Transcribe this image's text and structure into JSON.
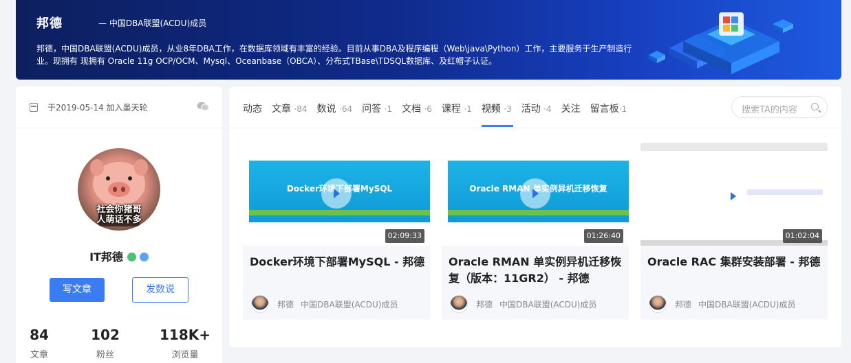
{
  "banner": {
    "name": "邦德",
    "org": "— 中国DBA联盟(ACDU)成员",
    "bio": "邦德，中国DBA联盟(ACDU)成员，从业8年DBA工作，在数据库领域有丰富的经验。目前从事DBA及程序编程（Web\\java\\Python）工作，主要服务于生产制造行业。现拥有 现拥有 Oracle 11g OCP/OCM、Mysql、Oceanbase（OBCA）、分布式TBase\\TDSQL数据库、及红帽子认证。"
  },
  "profile": {
    "joined": "于2019-05-14 加入墨天轮",
    "avatar_caption_1": "社会你猪哥",
    "avatar_caption_2": "人萌话不多",
    "username": "IT邦德",
    "write_button": "写文章",
    "post_button": "发数说",
    "stats": [
      {
        "num": "84",
        "label": "文章"
      },
      {
        "num": "102",
        "label": "粉丝"
      },
      {
        "num": "118K+",
        "label": "浏览量"
      }
    ]
  },
  "tabs": [
    {
      "label": "动态",
      "count": ""
    },
    {
      "label": "文章",
      "count": "·84"
    },
    {
      "label": "数说",
      "count": "·64"
    },
    {
      "label": "问答",
      "count": "·1"
    },
    {
      "label": "文档",
      "count": "·6"
    },
    {
      "label": "课程",
      "count": "·1"
    },
    {
      "label": "视频",
      "count": "·3"
    },
    {
      "label": "活动",
      "count": "·4"
    },
    {
      "label": "关注",
      "count": ""
    },
    {
      "label": "留言板",
      "count": "·1"
    }
  ],
  "active_tab": "视频",
  "search": {
    "placeholder": "搜索TA的内容"
  },
  "videos": [
    {
      "thumb_title": "Docker环境下部署MySQL",
      "duration": "02:09:33",
      "title": "Docker环境下部署MySQL - 邦德",
      "author": "邦德",
      "author_org": "中国DBA联盟(ACDU)成员"
    },
    {
      "thumb_title": "Oracle RMAN 单实例异机迁移恢复",
      "duration": "01:26:40",
      "title": "Oracle RMAN 单实例异机迁移恢复（版本：11GR2） - 邦德",
      "author": "邦德",
      "author_org": "中国DBA联盟(ACDU)成员"
    },
    {
      "thumb_title": "",
      "duration": "01:02:04",
      "title": "Oracle RAC 集群安装部署 - 邦德",
      "author": "邦德",
      "author_org": "中国DBA联盟(ACDU)成员"
    }
  ],
  "colors": {
    "accent": "#3b7cf2",
    "banner_dark": "#0d1f5e",
    "thumb_blue": "#1db3e6",
    "thumb_green": "#6cc24a"
  }
}
